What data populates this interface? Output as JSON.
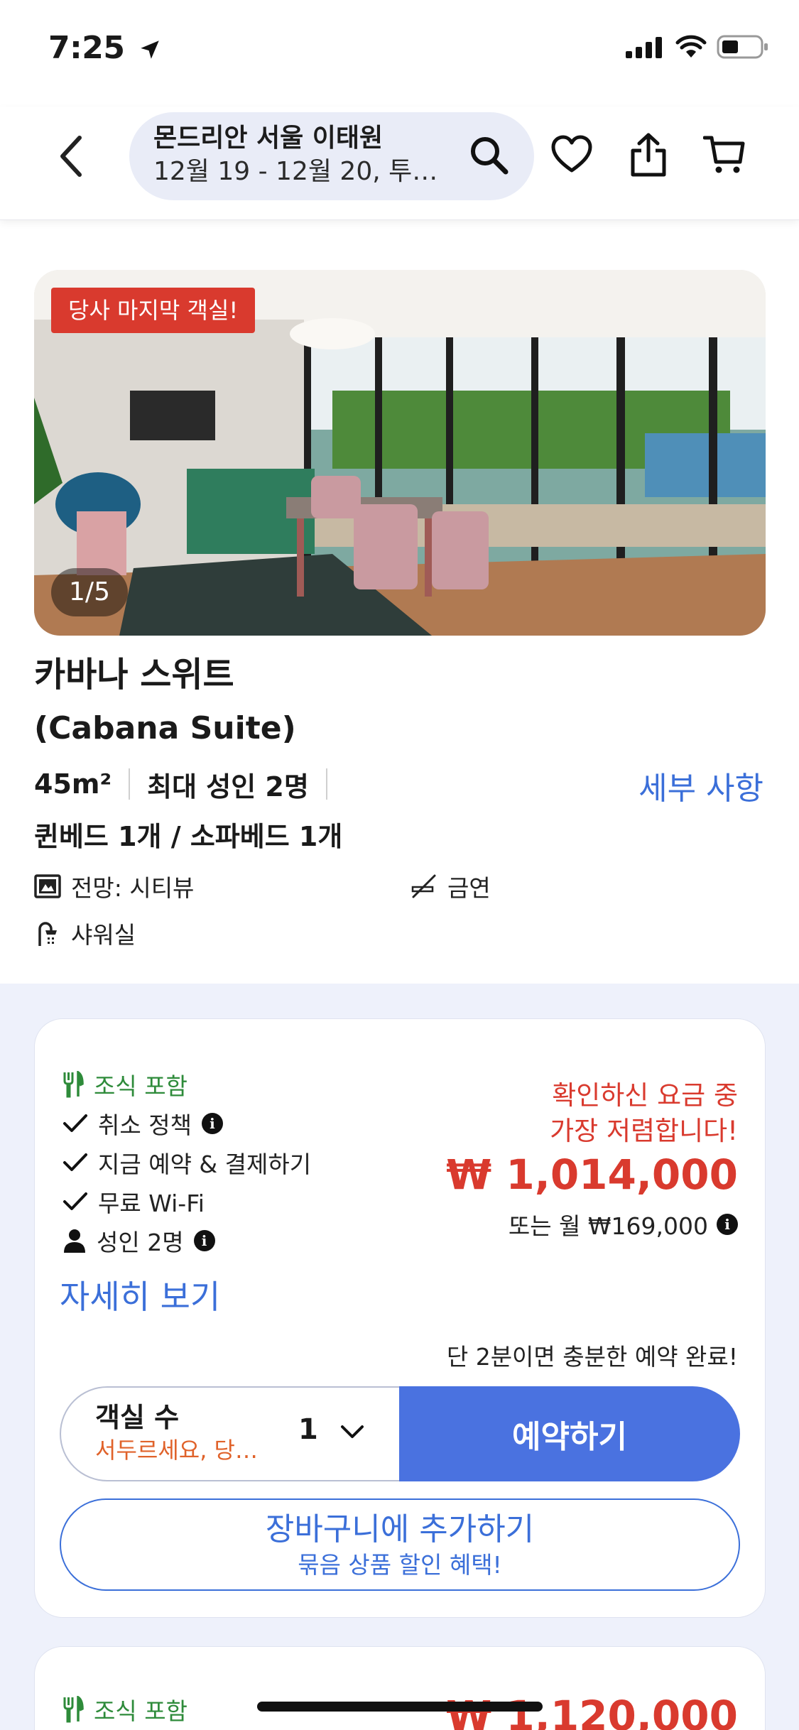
{
  "status_bar": {
    "time": "7:25"
  },
  "header": {
    "title": "몬드리안 서울 이태원",
    "subtitle": "12월 19 - 12월 20, 투…"
  },
  "room": {
    "badge": "당사 마지막 객실!",
    "photo_counter": "1/5",
    "name": "카바나 스위트",
    "name_en": "(Cabana Suite)",
    "size": "45m²",
    "occupancy": "최대 성인 2명",
    "details_link": "세부 사항",
    "beds": "퀸베드 1개 / 소파베드 1개",
    "amenities": {
      "view": "전망: 시티뷰",
      "smoking": "금연",
      "bath": "샤워실"
    }
  },
  "offer": {
    "breakfast": "조식 포함",
    "cancellation": "취소 정책",
    "pay_now": "지금 예약 & 결제하기",
    "wifi": "무료 Wi-Fi",
    "adults": "성인 2명",
    "more_link": "자세히 보기",
    "promo_line1": "확인하신 요금 중",
    "promo_line2": "가장 저렴합니다!",
    "price": "₩ 1,014,000",
    "monthly": "또는 월 ₩169,000",
    "quick_note": "단 2분이면 충분한 예약 완료!",
    "rooms_label": "객실 수",
    "rooms_hint": "서두르세요, 당…",
    "rooms_qty": "1",
    "book_label": "예약하기",
    "cart_label": "장바구니에 추가하기",
    "cart_sub": "묶음 상품 할인 혜택!"
  },
  "offer2": {
    "breakfast": "조식 포함",
    "price": "₩ 1,120,000"
  },
  "colors": {
    "accent_blue": "#3b6fd9",
    "button_blue": "#4a72e0",
    "sale_red": "#d93a2e",
    "breakfast_green": "#2e8b3a",
    "hint_orange": "#e0622a"
  }
}
